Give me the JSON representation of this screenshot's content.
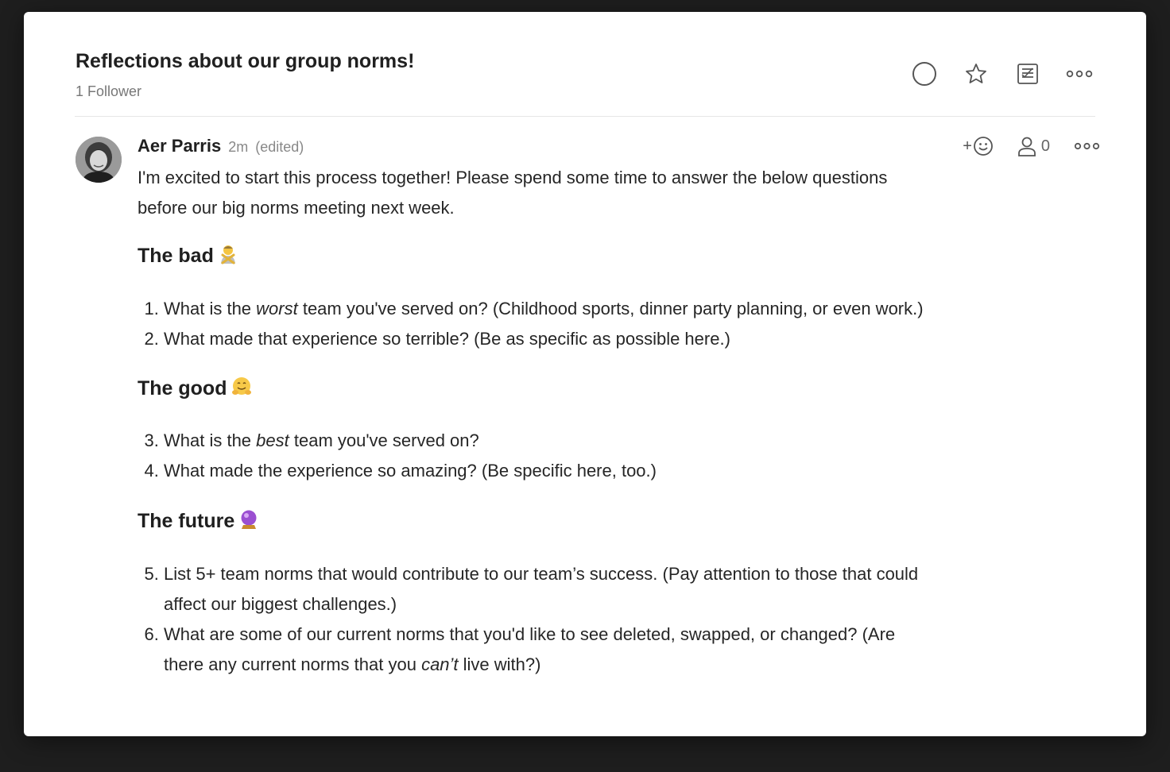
{
  "thread": {
    "title": "Reflections about our group norms!",
    "followers": "1 Follower"
  },
  "header_actions": [
    {
      "name": "mark-done",
      "icon": "circle-icon"
    },
    {
      "name": "favorite",
      "icon": "star-icon"
    },
    {
      "name": "add-to-todo",
      "icon": "checklist-icon"
    },
    {
      "name": "more",
      "icon": "ellipsis-icon"
    }
  ],
  "comment": {
    "author": "Aer Parris",
    "time": "2m",
    "edited": "(edited)",
    "reaction_label": "+",
    "follower_count": "0",
    "intro": "I'm excited to start this process together! Please spend some time to answer the below questions before our big norms meeting next week.",
    "sections": [
      {
        "heading": "The bad",
        "emoji": "person-gesturing-no",
        "items": [
          {
            "before": "What is the ",
            "em": "worst",
            "after": " team you've served on? (Childhood sports, dinner party planning, or even work.)"
          },
          {
            "before": "What made that experience so terrible? (Be as specific as possible here.)",
            "em": "",
            "after": ""
          }
        ]
      },
      {
        "heading": "The good",
        "emoji": "hugging-face",
        "items": [
          {
            "before": "What is the ",
            "em": "best",
            "after": " team you've served on?"
          },
          {
            "before": "What made the experience so amazing? (Be specific here, too.)",
            "em": "",
            "after": ""
          }
        ]
      },
      {
        "heading": "The future",
        "emoji": "crystal-ball",
        "items": [
          {
            "before": "List 5+ team norms that would contribute to our team’s success. (Pay attention to those that could affect our biggest challenges.)",
            "em": "",
            "after": ""
          },
          {
            "before": "What are some of our current norms that you'd like to see deleted, swapped, or changed? (Are there any current norms that you ",
            "em": "can’t",
            "after": " live with?)"
          }
        ]
      }
    ]
  }
}
